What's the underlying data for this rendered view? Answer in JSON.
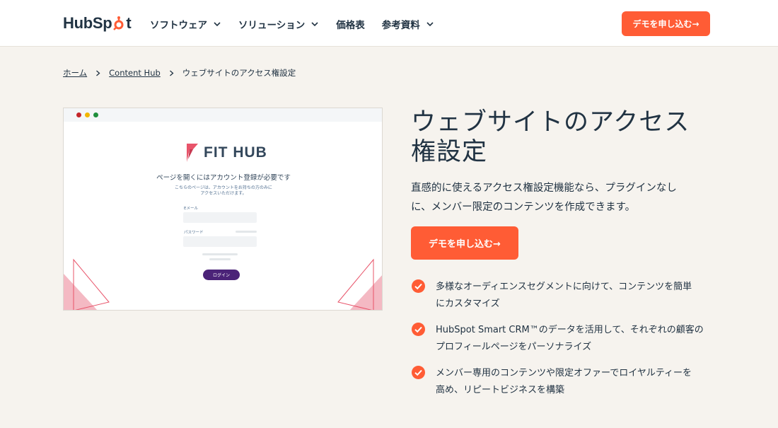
{
  "header": {
    "logo_pre": "HubSp",
    "logo_post": "t",
    "nav": [
      {
        "label": "ソフトウェア",
        "has_dropdown": true
      },
      {
        "label": "ソリューション",
        "has_dropdown": true
      },
      {
        "label": "価格表",
        "has_dropdown": false
      },
      {
        "label": "参考資料",
        "has_dropdown": true
      }
    ],
    "cta_label": "デモを申し込む→"
  },
  "breadcrumb": {
    "items": [
      "ホーム",
      "Content Hub"
    ],
    "current": "ウェブサイトのアクセス権設定"
  },
  "mock": {
    "logo_text": "FIT HUB",
    "title": "ページを開くにはアカウント登録が必要です",
    "subtitle_line1": "こちらのページは、アカウントをお持ちの方のみに",
    "subtitle_line2": "アクセスいただけます。",
    "email_label": "Eメール",
    "password_label": "パスワード",
    "login_label": "ログイン"
  },
  "hero": {
    "title_line1": "ウェブサイトのアクセス",
    "title_line2": "権設定",
    "desc_line1": "直感的に使えるアクセス権設定機能なら、プラグインなし",
    "desc_line2": "に、メンバー限定のコンテンツを作成できます。",
    "cta_label": "デモを申し込む→"
  },
  "features": [
    {
      "line1": "多様なオーディエンスセグメントに向けて、コンテンツを簡単",
      "line2": "にカスタマイズ"
    },
    {
      "line1": "HubSpot Smart CRM™のデータを活用して、それぞれの顧客の",
      "line2": "プロフィールページをパーソナライズ"
    },
    {
      "line1": "メンバー専用のコンテンツや限定オファーでロイヤルティーを",
      "line2": "高め、リピートビジネスを構築"
    }
  ],
  "colors": {
    "accent": "#ff5c35",
    "page_bg": "#f6f3ee",
    "text": "#213343",
    "mock_button": "#4b2378",
    "mock_accent": "#e8546a"
  },
  "icons": {
    "dropdown": "chevron-down-icon",
    "breadcrumb_separator": "chevron-right-icon",
    "feature_bullet": "check-circle-icon"
  }
}
